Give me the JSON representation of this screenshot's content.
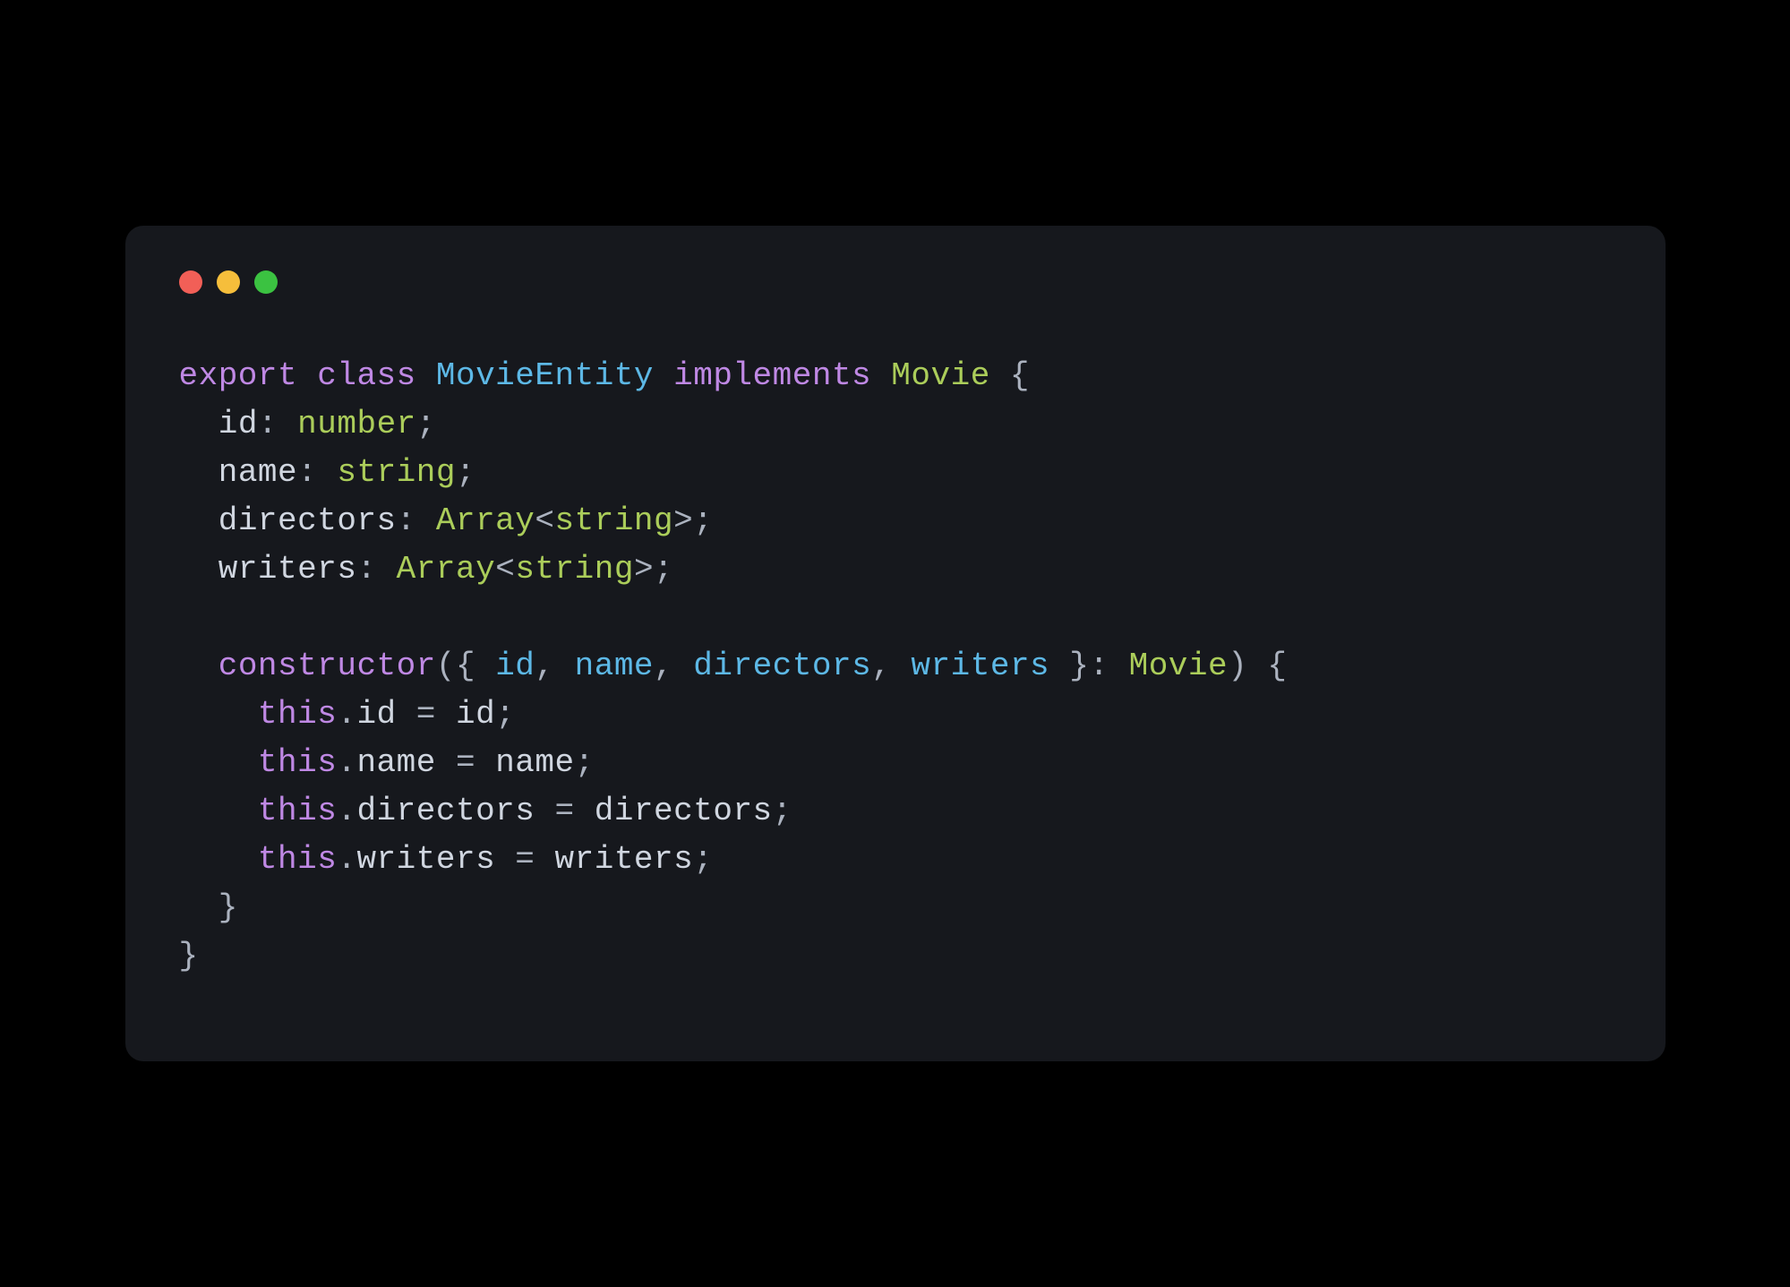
{
  "code": {
    "line1": {
      "export": "export",
      "class": "class",
      "className": "MovieEntity",
      "implements": "implements",
      "interfaceName": "Movie",
      "brace": "{"
    },
    "line2": {
      "indent": "  ",
      "property": "id",
      "colon": ":",
      "type": "number",
      "semicolon": ";"
    },
    "line3": {
      "indent": "  ",
      "property": "name",
      "colon": ":",
      "type": "string",
      "semicolon": ";"
    },
    "line4": {
      "indent": "  ",
      "property": "directors",
      "colon": ":",
      "arrayType": "Array",
      "lt": "<",
      "innerType": "string",
      "gt": ">",
      "semicolon": ";"
    },
    "line5": {
      "indent": "  ",
      "property": "writers",
      "colon": ":",
      "arrayType": "Array",
      "lt": "<",
      "innerType": "string",
      "gt": ">",
      "semicolon": ";"
    },
    "line7": {
      "indent": "  ",
      "constructor": "constructor",
      "openParen": "(",
      "openBrace": "{",
      "param1": "id",
      "comma1": ",",
      "param2": "name",
      "comma2": ",",
      "param3": "directors",
      "comma3": ",",
      "param4": "writers",
      "closeBrace": "}",
      "colon": ":",
      "type": "Movie",
      "closeParen": ")",
      "bodyBrace": "{"
    },
    "line8": {
      "indent": "    ",
      "this": "this",
      "dot": ".",
      "property": "id",
      "equals": "=",
      "value": "id",
      "semicolon": ";"
    },
    "line9": {
      "indent": "    ",
      "this": "this",
      "dot": ".",
      "property": "name",
      "equals": "=",
      "value": "name",
      "semicolon": ";"
    },
    "line10": {
      "indent": "    ",
      "this": "this",
      "dot": ".",
      "property": "directors",
      "equals": "=",
      "value": "directors",
      "semicolon": ";"
    },
    "line11": {
      "indent": "    ",
      "this": "this",
      "dot": ".",
      "property": "writers",
      "equals": "=",
      "value": "writers",
      "semicolon": ";"
    },
    "line12": {
      "indent": "  ",
      "brace": "}"
    },
    "line13": {
      "brace": "}"
    }
  }
}
